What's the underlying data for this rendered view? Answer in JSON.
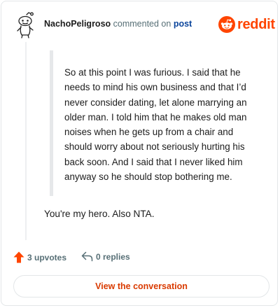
{
  "header": {
    "username": "NachoPeligroso",
    "action_text": "commented on",
    "target_link": "post"
  },
  "brand": {
    "wordmark": "reddit",
    "color": "#ff4500",
    "logo_icon": "reddit-snoo-icon"
  },
  "quote": {
    "text": "So at this point I was furious. I said that he needs to mind his own business and that I’d never consider dating, let alone marrying an older man. I told him that he makes old man noises when he gets up from a chair and should worry about not seriously hurting his back soon. And I said that I never liked him anyway so he should stop bothering me."
  },
  "comment": {
    "text": "You're my hero. Also NTA."
  },
  "actions": {
    "upvotes": "3 upvotes",
    "upvote_icon": "upvote-arrow-icon",
    "upvote_color": "#ff4500",
    "replies": "0 replies",
    "reply_icon": "reply-arrow-icon"
  },
  "cta": {
    "label": "View the conversation",
    "color": "#d93a00"
  }
}
